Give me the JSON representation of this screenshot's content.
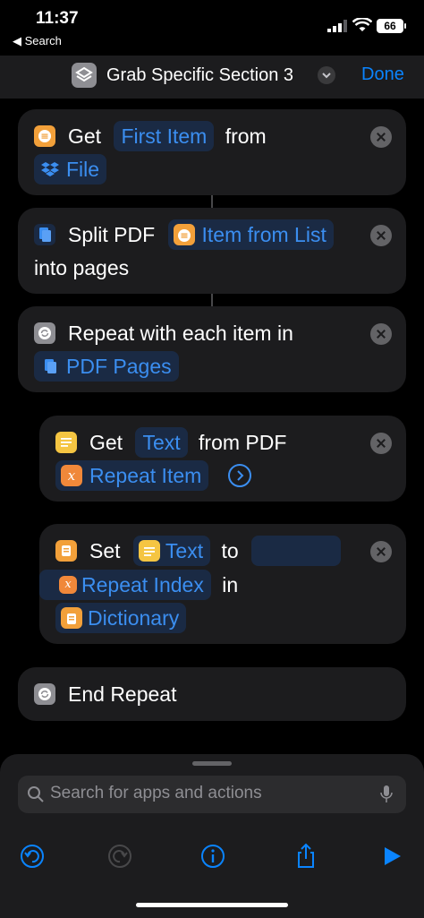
{
  "status": {
    "time": "11:37",
    "back_label": "◀ Search",
    "battery": "66"
  },
  "nav": {
    "title": "Grab Specific Section 3",
    "done_label": "Done"
  },
  "actions": {
    "get1": {
      "verb": "Get",
      "param1": "First Item",
      "word": "from",
      "param2": "File"
    },
    "split": {
      "verb": "Split PDF",
      "param": "Item from List",
      "suffix": "into pages"
    },
    "repeat": {
      "verb": "Repeat with each item in",
      "param": "PDF Pages"
    },
    "get2": {
      "verb": "Get",
      "param1": "Text",
      "word": "from PDF",
      "param2": "Repeat Item"
    },
    "set": {
      "verb": "Set",
      "param1": "Text",
      "word": "to",
      "param2": "Repeat Index",
      "word2": "in",
      "param3": "Dictionary"
    },
    "end": {
      "verb": "End Repeat"
    }
  },
  "search": {
    "placeholder": "Search for apps and actions"
  },
  "colors": {
    "accent": "#0a84ff",
    "card": "#1c1c1e",
    "variable_orange": "#f0883a",
    "list_orange": "#f2a03a",
    "text_yellow": "#f5c542",
    "dropbox_blue": "#0061fe"
  },
  "icons": [
    "list-icon",
    "dropbox-icon",
    "document-icon",
    "repeat-icon",
    "text-icon",
    "variable-icon",
    "dictionary-icon",
    "chevron-right-circle-icon",
    "search-icon",
    "microphone-icon",
    "undo-icon",
    "redo-icon",
    "info-icon",
    "share-icon",
    "play-icon"
  ]
}
